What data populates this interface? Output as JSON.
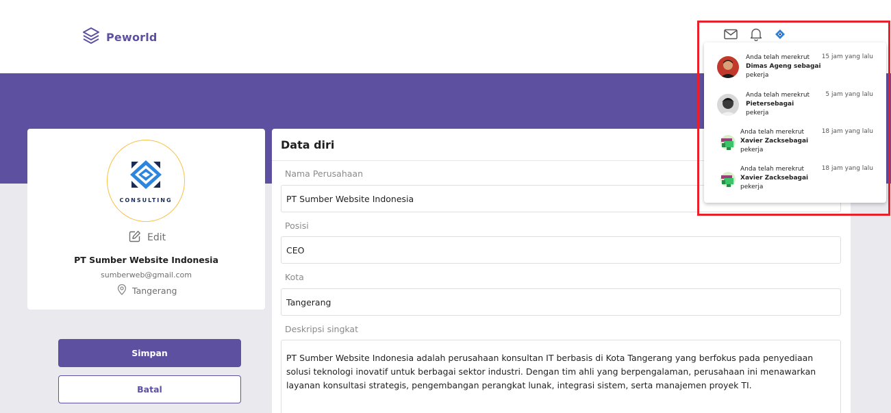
{
  "header": {
    "brand": "Peworld",
    "icons": [
      "mail-icon",
      "bell-icon",
      "company-logo-icon"
    ]
  },
  "profile": {
    "logo_text": "CONSULTING",
    "edit_label": "Edit",
    "company_name": "PT Sumber Website Indonesia",
    "email": "sumberweb@gmail.com",
    "location": "Tangerang"
  },
  "actions": {
    "save_label": "Simpan",
    "cancel_label": "Batal"
  },
  "form": {
    "title": "Data diri",
    "company_label": "Nama Perusahaan",
    "company_value": "PT Sumber Website Indonesia",
    "position_label": "Posisi",
    "position_value": "CEO",
    "city_label": "Kota",
    "city_value": "Tangerang",
    "description_label": "Deskripsi singkat",
    "description_value": "PT Sumber Website Indonesia adalah perusahaan konsultan IT berbasis di Kota Tangerang yang berfokus pada penyediaan solusi teknologi inovatif untuk berbagai sektor industri. Dengan tim ahli yang berpengalaman, perusahaan ini menawarkan layanan konsultasi strategis, pengembangan perangkat lunak, integrasi sistem, serta manajemen proyek TI."
  },
  "notifications": [
    {
      "prefix": "Anda telah merekrut",
      "who": "Dimas Ageng sebagai",
      "suffix": "pekerja",
      "time": "15 jam yang lalu"
    },
    {
      "prefix": "Anda telah merekrut",
      "who": "Pietersebagai",
      "suffix": "pekerja",
      "time": "5 jam yang lalu"
    },
    {
      "prefix": "Anda telah merekrut",
      "who": "Xavier Zacksebagai",
      "suffix": "pekerja",
      "time": "18 jam yang lalu"
    },
    {
      "prefix": "Anda telah merekrut",
      "who": "Xavier Zacksebagai",
      "suffix": "pekerja",
      "time": "18 jam yang lalu"
    }
  ],
  "colors": {
    "brand": "#5e50a1",
    "highlight": "#e8202a",
    "logo_ring": "#f5c242"
  }
}
